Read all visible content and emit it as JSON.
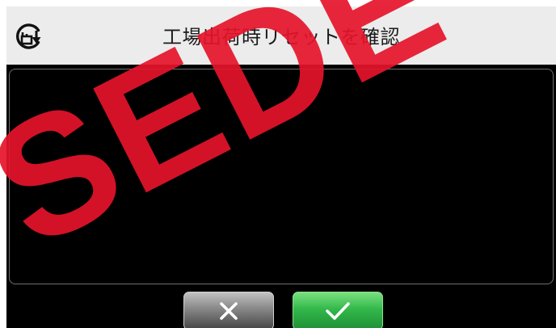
{
  "header": {
    "title": "工場出荷時リセットを確認",
    "icon": "factory-reset-icon"
  },
  "buttons": {
    "cancel": {
      "icon": "close-x-icon",
      "color": "#8c8c8c"
    },
    "confirm": {
      "icon": "check-icon",
      "color": "#32b84a"
    }
  },
  "watermark": {
    "text": "SEDE",
    "color": "#e5132a"
  }
}
